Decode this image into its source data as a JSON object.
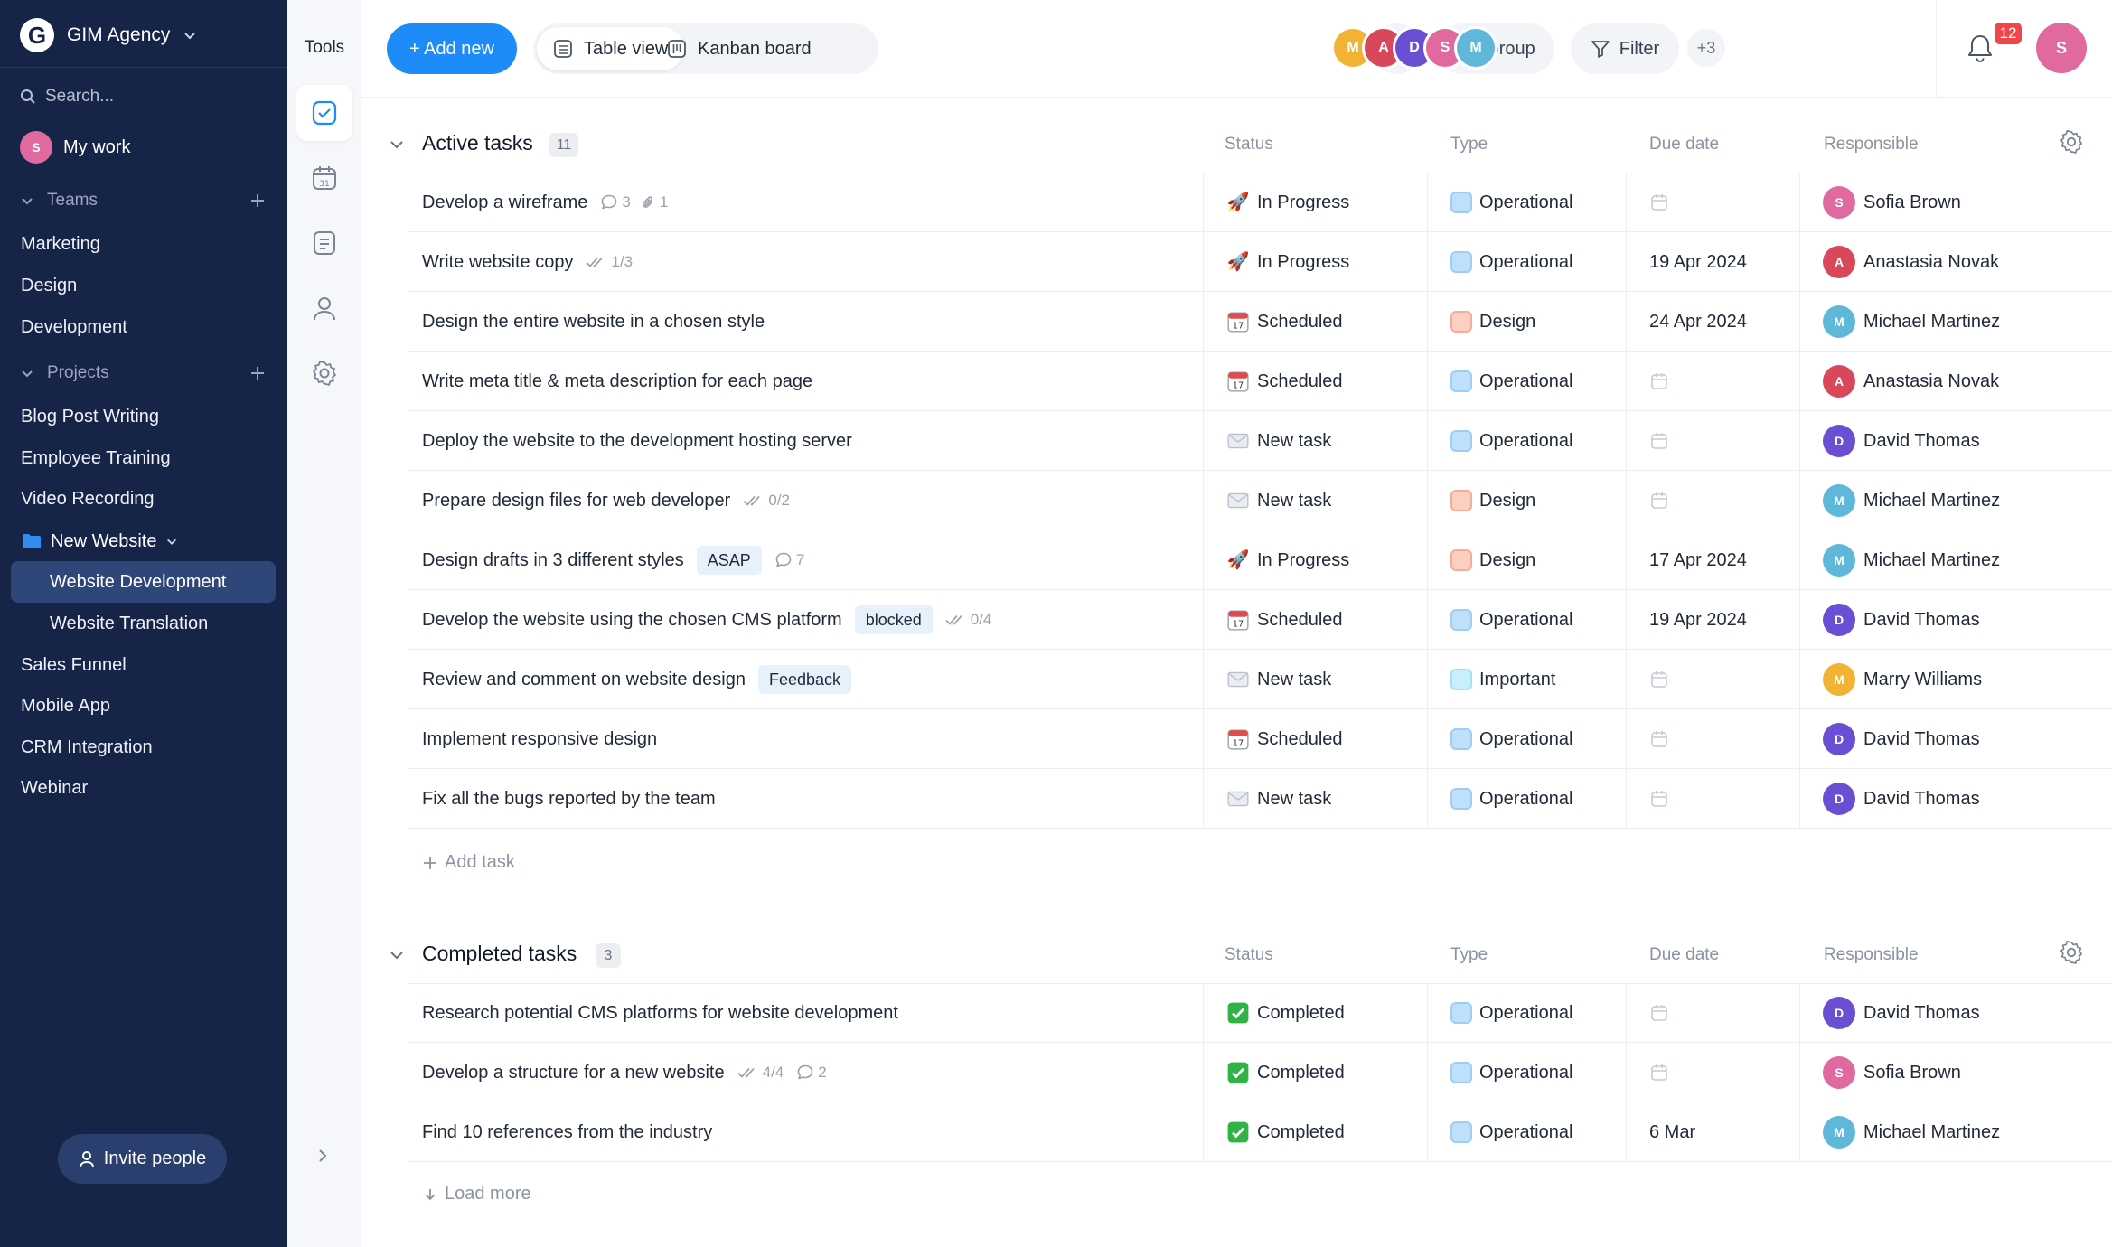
{
  "workspace": {
    "name": "GIM Agency",
    "logo_letter": "G"
  },
  "sidebar": {
    "search_placeholder": "Search...",
    "my_work": "My work",
    "teams_label": "Teams",
    "teams": [
      "Marketing",
      "Design",
      "Development"
    ],
    "projects_label": "Projects",
    "projects_top": [
      "Blog Post Writing",
      "Employee Training",
      "Video Recording"
    ],
    "folder": "New Website",
    "folder_items": [
      "Website Development",
      "Website Translation"
    ],
    "projects_bottom": [
      "Sales Funnel",
      "Mobile App",
      "CRM Integration",
      "Webinar"
    ],
    "invite": "Invite people"
  },
  "tools": {
    "title": "Tools"
  },
  "topbar": {
    "add_new": "+ Add new",
    "table_view": "Table view",
    "kanban": "Kanban board",
    "group": "Group",
    "filter": "Filter",
    "more_members": "+3",
    "notifications": "12"
  },
  "columns": {
    "status": "Status",
    "type": "Type",
    "due": "Due date",
    "responsible": "Responsible"
  },
  "active": {
    "title": "Active tasks",
    "count": "11",
    "add_task": "Add task",
    "rows": [
      {
        "name": "Develop a wireframe",
        "comments": "3",
        "attachments": "1",
        "status": "In Progress",
        "type": "Operational",
        "due": "",
        "resp": "Sofia Brown"
      },
      {
        "name": "Write website copy",
        "checks": "1/3",
        "status": "In Progress",
        "type": "Operational",
        "due": "19 Apr 2024",
        "resp": "Anastasia Novak"
      },
      {
        "name": "Design the entire website in a chosen style",
        "status": "Scheduled",
        "type": "Design",
        "due": "24 Apr 2024",
        "resp": "Michael Martinez"
      },
      {
        "name": "Write meta title & meta description for each page",
        "status": "Scheduled",
        "type": "Operational",
        "due": "",
        "resp": "Anastasia Novak"
      },
      {
        "name": "Deploy the website to the development hosting server",
        "status": "New task",
        "type": "Operational",
        "due": "",
        "resp": "David Thomas"
      },
      {
        "name": "Prepare design files for web developer",
        "checks": "0/2",
        "status": "New task",
        "type": "Design",
        "due": "",
        "resp": "Michael Martinez"
      },
      {
        "name": "Design drafts in 3 different styles",
        "tag": "ASAP",
        "comments": "7",
        "status": "In Progress",
        "type": "Design",
        "due": "17 Apr 2024",
        "resp": "Michael Martinez"
      },
      {
        "name": "Develop the website using the chosen CMS platform",
        "tag": "blocked",
        "checks": "0/4",
        "status": "Scheduled",
        "type": "Operational",
        "due": "19 Apr 2024",
        "resp": "David Thomas"
      },
      {
        "name": "Review and comment on website design",
        "tag": "Feedback",
        "status": "New task",
        "type": "Important",
        "due": "",
        "resp": "Marry Williams"
      },
      {
        "name": "Implement responsive design",
        "status": "Scheduled",
        "type": "Operational",
        "due": "",
        "resp": "David Thomas"
      },
      {
        "name": "Fix all the bugs reported by the team",
        "status": "New task",
        "type": "Operational",
        "due": "",
        "resp": "David Thomas"
      }
    ]
  },
  "completed": {
    "title": "Completed tasks",
    "count": "3",
    "load_more": "Load more",
    "rows": [
      {
        "name": "Research potential CMS platforms for website development",
        "status": "Completed",
        "type": "Operational",
        "due": "",
        "resp": "David Thomas"
      },
      {
        "name": "Develop a structure for a new website",
        "checks": "4/4",
        "comments": "2",
        "status": "Completed",
        "type": "Operational",
        "due": "",
        "resp": "Sofia Brown"
      },
      {
        "name": "Find 10 references from the industry",
        "status": "Completed",
        "type": "Operational",
        "due": "6 Mar",
        "resp": "Michael Martinez"
      }
    ]
  },
  "colors": {
    "sidebar_bg": "#162447",
    "accent": "#1d8cf8",
    "type_operational": "#bfe0fb",
    "type_design": "#fbd0c2",
    "type_important": "#c7f0fb",
    "badge": "#f0454a"
  },
  "avatar_colors": {
    "Sofia Brown": "#e06aa0",
    "Anastasia Novak": "#d9485a",
    "Michael Martinez": "#5fb8d9",
    "David Thomas": "#6a4fd4",
    "Marry Williams": "#f2b233"
  },
  "status_icons": {
    "In Progress": "🚀",
    "Scheduled": "📅",
    "New task": "✉",
    "Completed": "✅"
  }
}
